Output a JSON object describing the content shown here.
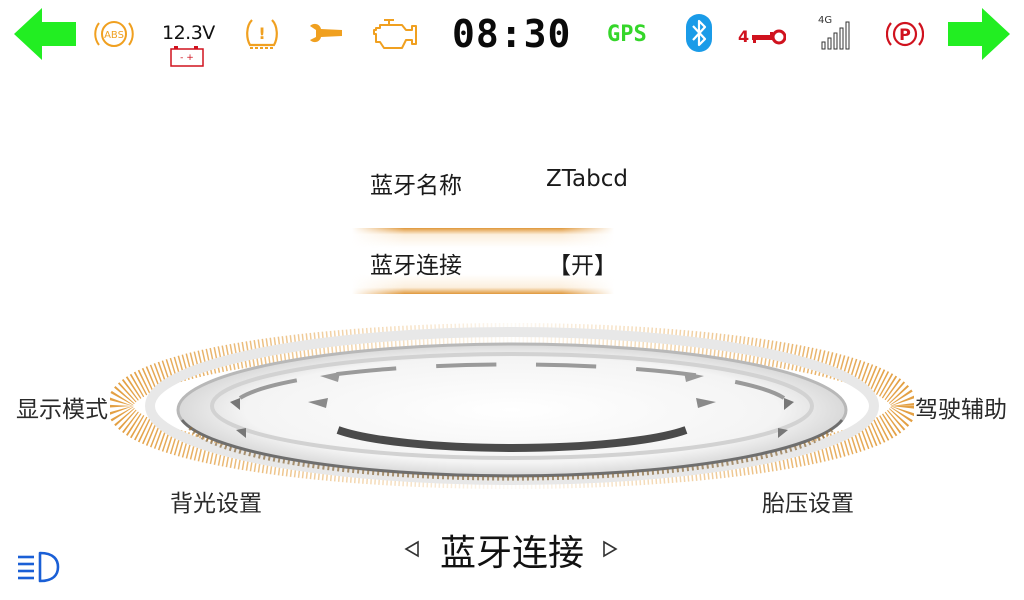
{
  "status_bar": {
    "battery_voltage": "12.3V",
    "battery_terminals": "- +",
    "abs_text": "ABS",
    "tpms_text": "!",
    "clock": "08:30",
    "gps_text": "GPS",
    "key_count": "4",
    "network_type": "4G",
    "parking_text": "P",
    "icons": [
      "back-arrow-icon",
      "abs-warning-icon",
      "battery-icon",
      "tire-pressure-warning-icon",
      "wrench-service-icon",
      "engine-check-icon",
      "gps-icon",
      "bluetooth-icon",
      "key-icon",
      "signal-strength-icon",
      "parking-brake-icon",
      "forward-arrow-icon"
    ],
    "colors": {
      "arrows": "#22ee22",
      "warning_amber": "#f0a020",
      "gps": "#35d62a",
      "bluetooth": "#1a9be8",
      "key_red": "#d0121e",
      "parking_red": "#d0121e"
    }
  },
  "bluetooth_settings": {
    "name_row": {
      "label": "蓝牙名称",
      "value": "ZTabcd"
    },
    "connect_row": {
      "label": "蓝牙连接",
      "value": "【开】",
      "selected": true
    }
  },
  "menu": {
    "left": "显示模式",
    "right": "驾驶辅助",
    "bottom_left": "背光设置",
    "bottom_right": "胎压设置",
    "current": "蓝牙连接"
  },
  "headlight_icon": "low-beam-headlight-icon",
  "accent_color": "#e0952e"
}
